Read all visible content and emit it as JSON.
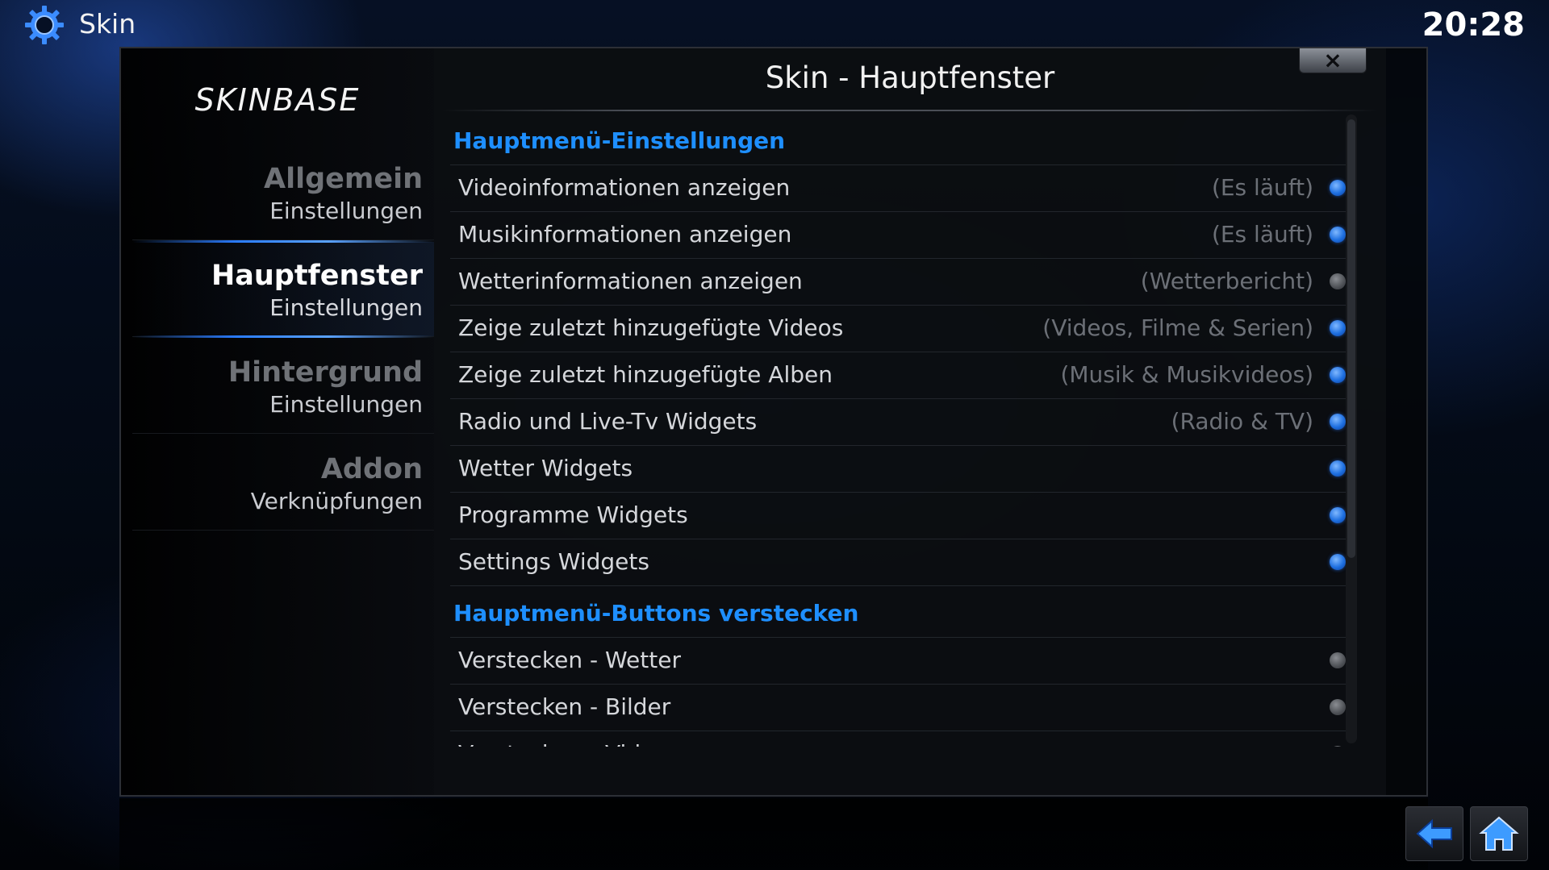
{
  "topbar": {
    "title": "Skin",
    "icon": "gear-icon",
    "clock": "20:28"
  },
  "sidebar": {
    "logo": "SKINBASE",
    "items": [
      {
        "title": "Allgemein",
        "subtitle": "Einstellungen",
        "active": false
      },
      {
        "title": "Hauptfenster",
        "subtitle": "Einstellungen",
        "active": true
      },
      {
        "title": "Hintergrund",
        "subtitle": "Einstellungen",
        "active": false
      },
      {
        "title": "Addon",
        "subtitle": "Verknüpfungen",
        "active": false
      }
    ]
  },
  "panel": {
    "title": "Skin - Hauptfenster",
    "close_label": "×",
    "sections": [
      {
        "header": "Hauptmenü-Einstellungen",
        "rows": [
          {
            "label": "Videoinformationen anzeigen",
            "value": "(Es läuft)",
            "enabled": true
          },
          {
            "label": "Musikinformationen anzeigen",
            "value": "(Es läuft)",
            "enabled": true
          },
          {
            "label": "Wetterinformationen anzeigen",
            "value": "(Wetterbericht)",
            "enabled": false
          },
          {
            "label": "Zeige zuletzt hinzugefügte Videos",
            "value": "(Videos, Filme & Serien)",
            "enabled": true
          },
          {
            "label": "Zeige zuletzt hinzugefügte Alben",
            "value": "(Musik & Musikvideos)",
            "enabled": true
          },
          {
            "label": "Radio und Live-Tv Widgets",
            "value": "(Radio & TV)",
            "enabled": true
          },
          {
            "label": "Wetter Widgets",
            "value": "",
            "enabled": true
          },
          {
            "label": "Programme Widgets",
            "value": "",
            "enabled": true
          },
          {
            "label": "Settings Widgets",
            "value": "",
            "enabled": true
          }
        ]
      },
      {
        "header": "Hauptmenü-Buttons verstecken",
        "rows": [
          {
            "label": "Verstecken - Wetter",
            "value": "",
            "enabled": false
          },
          {
            "label": "Verstecken - Bilder",
            "value": "",
            "enabled": false
          },
          {
            "label": "Verstecken - Videos",
            "value": "",
            "enabled": false
          }
        ]
      }
    ]
  },
  "footer": {
    "back_icon": "back-arrow-icon",
    "home_icon": "home-icon"
  },
  "colors": {
    "accent": "#1e8fff",
    "radio_on": "#1e6fe0",
    "radio_off": "#4d5055"
  }
}
